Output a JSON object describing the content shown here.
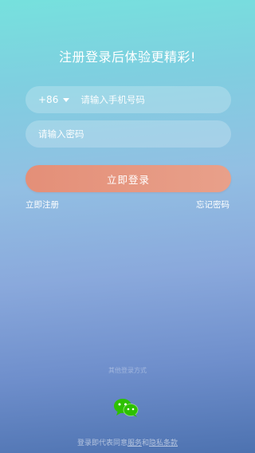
{
  "headline": "注册登录后体验更精彩!",
  "phone_field": {
    "country_code": "+86",
    "placeholder": "请输入手机号码"
  },
  "password_field": {
    "placeholder": "请输入密码"
  },
  "login_button": "立即登录",
  "register_link": "立即注册",
  "forgot_link": "忘记密码",
  "other_login_label": "其他登录方式",
  "social": {
    "icon": "wechat-icon",
    "color": "#2dc100"
  },
  "terms": {
    "prefix": "登录即代表同意",
    "service_link": "服务",
    "conjunction": "和",
    "privacy_link": "隐私条款"
  },
  "colors": {
    "login_button": "#e8957f",
    "background_top": "#76e1dd",
    "background_bottom": "#4d72b0"
  }
}
